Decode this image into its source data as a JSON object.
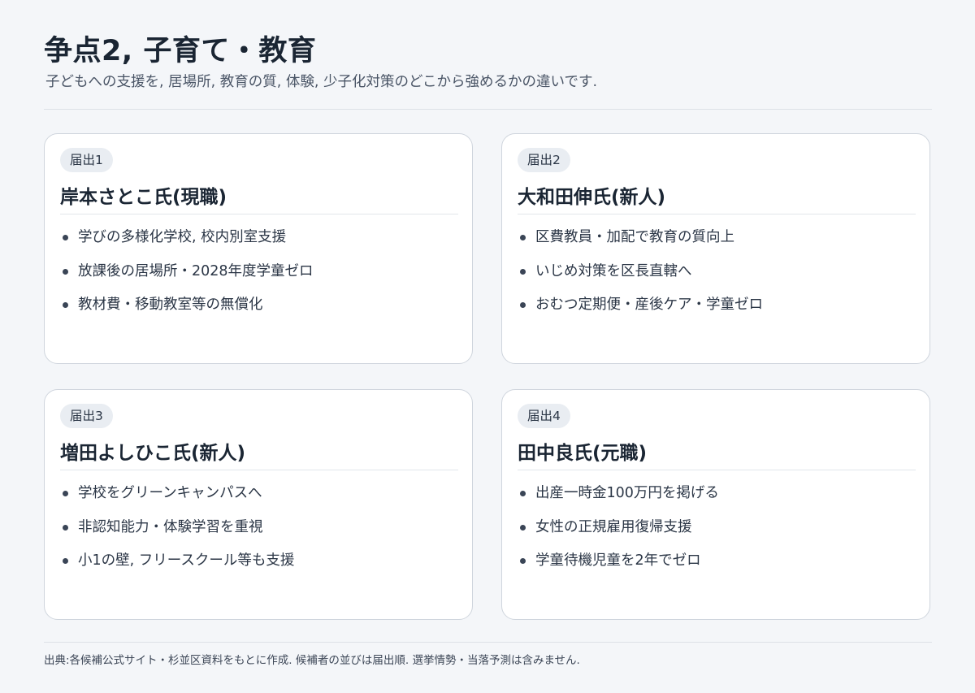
{
  "header": {
    "title": "争点2, 子育て・教育",
    "subtitle": "子どもへの支援を, 居場所, 教育の質, 体験, 少子化対策のどこから強めるかの違いです."
  },
  "candidates": [
    {
      "badge": "届出1",
      "name": "岸本さとこ氏(現職)",
      "points": [
        "学びの多様化学校, 校内別室支援",
        "放課後の居場所・2028年度学童ゼロ",
        "教材費・移動教室等の無償化"
      ]
    },
    {
      "badge": "届出2",
      "name": "大和田伸氏(新人)",
      "points": [
        "区費教員・加配で教育の質向上",
        "いじめ対策を区長直轄へ",
        "おむつ定期便・産後ケア・学童ゼロ"
      ]
    },
    {
      "badge": "届出3",
      "name": "増田よしひこ氏(新人)",
      "points": [
        "学校をグリーンキャンパスへ",
        "非認知能力・体験学習を重視",
        "小1の壁, フリースクール等も支援"
      ]
    },
    {
      "badge": "届出4",
      "name": "田中良氏(元職)",
      "points": [
        "出産一時金100万円を掲げる",
        "女性の正規雇用復帰支援",
        "学童待機児童を2年でゼロ"
      ]
    }
  ],
  "footer": {
    "note": "出典:各候補公式サイト・杉並区資料をもとに作成. 候補者の並びは届出順. 選挙情勢・当落予測は含みません."
  }
}
